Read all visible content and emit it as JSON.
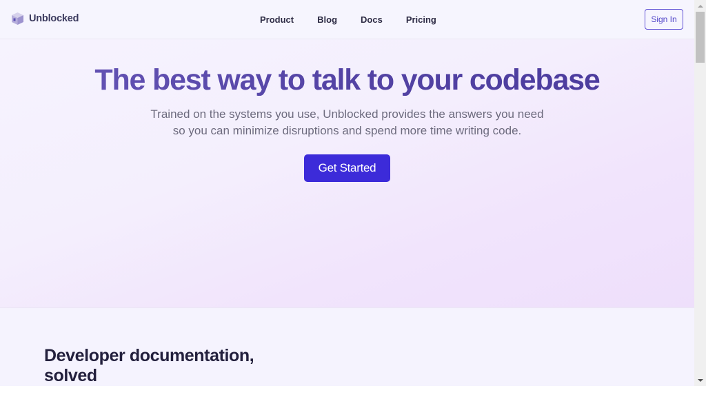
{
  "header": {
    "logo_text": "Unblocked",
    "logo_icon": "cube-icon",
    "nav": [
      {
        "label": "Product"
      },
      {
        "label": "Blog"
      },
      {
        "label": "Docs"
      },
      {
        "label": "Pricing"
      }
    ],
    "signin_label": "Sign In"
  },
  "hero": {
    "title": "The best way to talk to your codebase",
    "subtitle_line1": "Trained on the systems you use, Unblocked provides the answers you need",
    "subtitle_line2": "so you can minimize disruptions and spend more time writing code.",
    "cta_label": "Get Started"
  },
  "section": {
    "title_line1": "Developer documentation,",
    "title_line2": "solved"
  },
  "colors": {
    "accent": "#3c2bd9",
    "title_purple": "#5a4ba8",
    "signin_border": "#5d4ed4",
    "page_bg": "#f5f3fe"
  }
}
